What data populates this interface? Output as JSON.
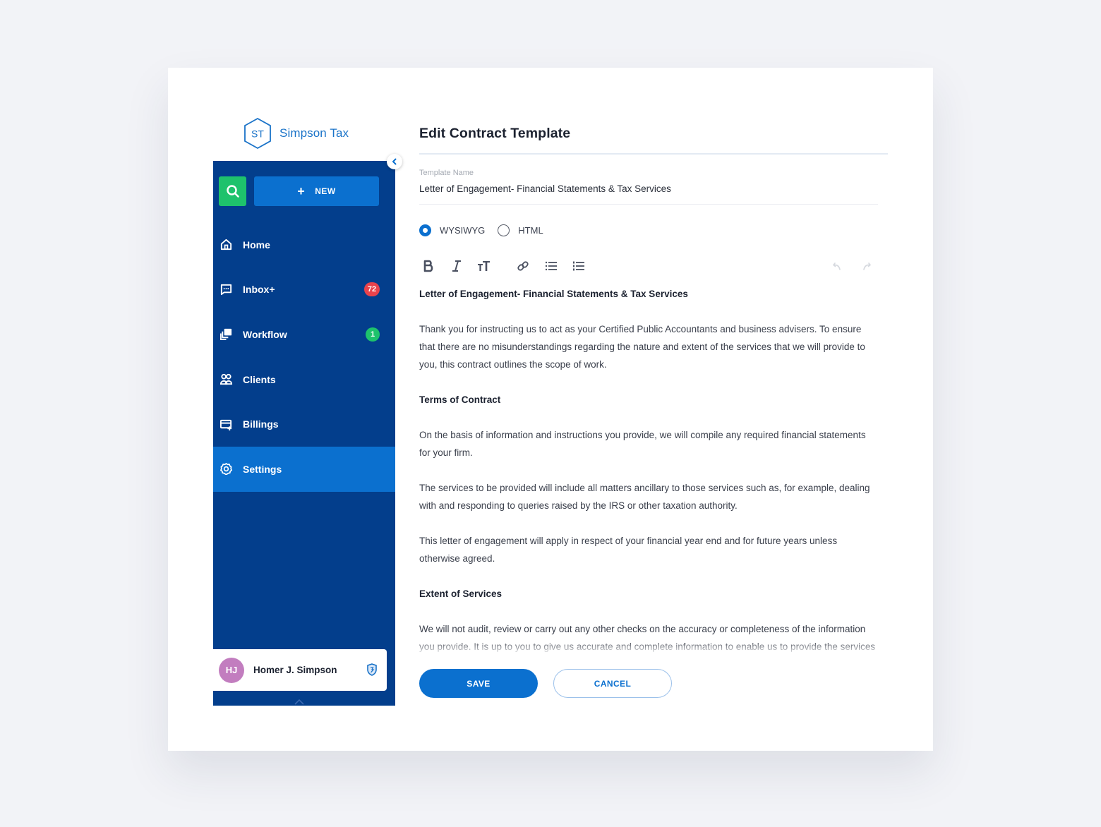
{
  "brand": {
    "logo_initials": "ST",
    "name": "Simpson Tax"
  },
  "colors": {
    "sidebar_bg": "#033e8c",
    "accent": "#0b70cf",
    "search_green": "#1ec26c",
    "badge_red": "#e8434c",
    "avatar_purple": "#c27dbf"
  },
  "sidebar": {
    "new_button_label": "NEW",
    "items": [
      {
        "label": "Home",
        "icon": "home-icon"
      },
      {
        "label": "Inbox+",
        "icon": "message-icon",
        "badge": "72"
      },
      {
        "label": "Workflow",
        "icon": "workflow-icon",
        "badge": "1"
      },
      {
        "label": "Clients",
        "icon": "clients-icon"
      },
      {
        "label": "Billings",
        "icon": "billing-icon"
      },
      {
        "label": "Settings",
        "icon": "gear-icon",
        "active": true
      }
    ],
    "user": {
      "initials": "HJ",
      "name": "Homer J. Simpson"
    }
  },
  "main": {
    "title": "Edit Contract Template",
    "template_name_label": "Template Name",
    "template_name_value": "Letter of Engagement- Financial Statements & Tax Services",
    "editor_modes": [
      {
        "label": "WYSIWYG",
        "selected": true
      },
      {
        "label": "HTML",
        "selected": false
      }
    ],
    "toolbar": [
      "bold",
      "italic",
      "text-size",
      "link",
      "bulleted-list",
      "numbered-list",
      "undo",
      "redo"
    ],
    "document": [
      {
        "type": "heading",
        "text": "Letter of Engagement- Financial Statements & Tax Services"
      },
      {
        "type": "paragraph",
        "text": "Thank you for instructing us to act as your Certified Public Accountants and business advisers. To ensure that there are no misunderstandings regarding the nature and extent of the services that we will provide to you, this contract outlines the scope of work."
      },
      {
        "type": "heading",
        "text": "Terms of Contract"
      },
      {
        "type": "paragraph",
        "text": "On the basis of information and instructions you provide, we will compile any required financial statements for your firm."
      },
      {
        "type": "paragraph",
        "text": "The services to be provided will include all matters ancillary to those services such as, for example, dealing with and responding to queries raised by the IRS or other taxation authority."
      },
      {
        "type": "paragraph",
        "text": "This letter of engagement will apply in respect of your financial year end and for future years unless otherwise agreed."
      },
      {
        "type": "heading",
        "text": "Extent of Services"
      },
      {
        "type": "paragraph",
        "text": "We will not audit, review or carry out any other checks on the accuracy or completeness of the information you provide. It is up to you to give us accurate and complete information to enable us to provide the services described in this letter and we accept no liability for the accuracy or"
      }
    ],
    "save_label": "SAVE",
    "cancel_label": "CANCEL"
  }
}
